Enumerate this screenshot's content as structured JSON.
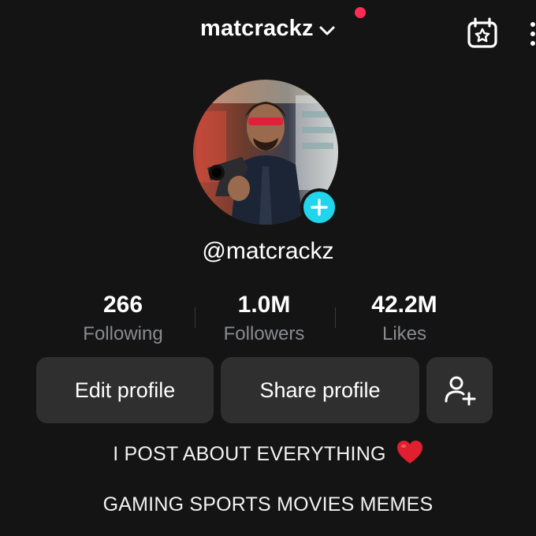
{
  "header": {
    "username": "matcrackz",
    "has_notification": true,
    "notification_color": "#fe2c55"
  },
  "profile": {
    "handle": "@matcrackz",
    "avatar_add_color": "#20d5ec"
  },
  "stats": [
    {
      "value": "266",
      "label": "Following"
    },
    {
      "value": "1.0M",
      "label": "Followers"
    },
    {
      "value": "42.2M",
      "label": "Likes"
    }
  ],
  "actions": {
    "edit_label": "Edit profile",
    "share_label": "Share profile"
  },
  "bio": {
    "line1": "I POST ABOUT EVERYTHING",
    "line1_emoji": "heart-emoji",
    "line2": "GAMING SPORTS MOVIES MEMES"
  },
  "icons": [
    "chevron-down-icon",
    "calendar-star-icon",
    "more-icon",
    "plus-icon",
    "add-friend-icon"
  ]
}
